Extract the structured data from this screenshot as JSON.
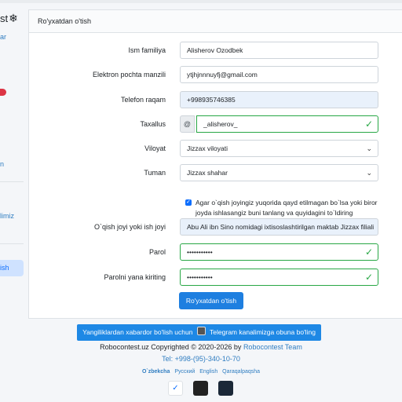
{
  "sidebar": {
    "brand_text": "st",
    "brand_icon": "snowflake-icon",
    "links": [
      "ar",
      "n",
      "limiz",
      "ish"
    ],
    "badge_color": "#dc3545",
    "active_item": "ish"
  },
  "card": {
    "title": "Ro'yxatdan o'tish",
    "fields": {
      "fullname": {
        "label": "Ism familiya",
        "value": "Alisherov Ozodbek"
      },
      "email": {
        "label": "Elektron pochta manzili",
        "value": "ytjhjnnnuyfj@gmail.com"
      },
      "phone": {
        "label": "Telefon raqam",
        "value": "+998935746385"
      },
      "username": {
        "label": "Taxallus",
        "prefix": "@",
        "value": "_alisherov_"
      },
      "region": {
        "label": "Viloyat",
        "value": "Jizzax viloyati"
      },
      "district": {
        "label": "Tuman",
        "value": "Jizzax shahar"
      },
      "checkbox_text": "Agar o`qish joyingiz yuqorida qayd etilmagan bo`lsa yoki biror joyda ishlasangiz buni tanlang va quyidagini to`ldiring",
      "workplace": {
        "label": "O`qish joyi yoki ish joyi",
        "value": "Abu Ali ibn Sino nomidagi ixtisoslashtirilgan maktab Jizzax filiali"
      },
      "password": {
        "label": "Parol",
        "value": "•••••••••••"
      },
      "password_confirm": {
        "label": "Parolni yana kiriting",
        "value": "•••••••••••"
      }
    },
    "submit_label": "Ro'yxatdan o'tish"
  },
  "footer": {
    "telegram_before": "Yangiliklardan xabardor bo'lish uchun",
    "telegram_after": "Telegram kanalimizga obuna bo'ling",
    "copyright_prefix": "Robocontest.uz Copyrighted © 2020-2026 by",
    "copyright_link": "Robocontest Team",
    "phone": "Tel: +998-(95)-340-10-70",
    "languages": [
      "O`zbekcha",
      "Русский",
      "English",
      "Qaraqalpaqsha"
    ],
    "active_language": "O`zbekcha"
  },
  "colors": {
    "accent": "#1e7fe0",
    "valid": "#28a745",
    "readonly_bg": "#e9f1fb"
  }
}
